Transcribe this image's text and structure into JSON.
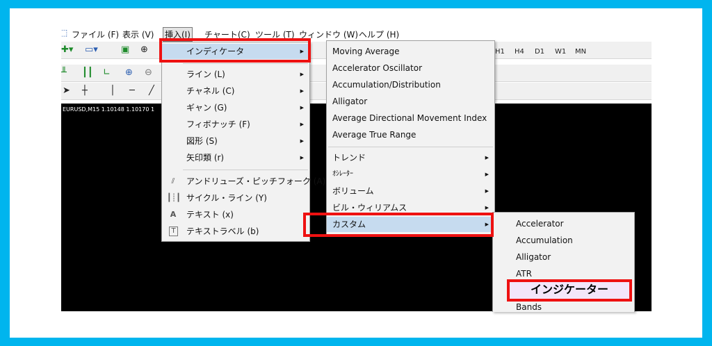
{
  "menubar": {
    "items": [
      {
        "label": "ファイル (F)"
      },
      {
        "label": "表示 (V)"
      },
      {
        "label": "挿入(I)"
      },
      {
        "label": "チャート(C)"
      },
      {
        "label": "ツール (T)"
      },
      {
        "label": "ウィンドウ (W)"
      },
      {
        "label": "ヘルプ (H)"
      }
    ]
  },
  "toolbar": {
    "timeframes": [
      "H1",
      "H4",
      "D1",
      "W1",
      "MN"
    ]
  },
  "chart": {
    "label": "EURUSD,M15  1.10148 1.10170 1"
  },
  "insert_menu": {
    "indicator_label": "インディケータ",
    "items": [
      {
        "label": "ライン (L)"
      },
      {
        "label": "チャネル (C)"
      },
      {
        "label": "ギャン (G)"
      },
      {
        "label": "フィボナッチ (F)"
      },
      {
        "label": "図形 (S)"
      },
      {
        "label": "矢印類 (r)"
      }
    ],
    "tools": [
      {
        "label": "アンドリューズ・ピッチフォーク (A)",
        "icon": "pitchfork-icon"
      },
      {
        "label": "サイクル・ライン (Y)",
        "icon": "cycle-lines-icon"
      },
      {
        "label": "テキスト (x)",
        "icon": "text-icon",
        "glyph": "A"
      },
      {
        "label": "テキストラベル (b)",
        "icon": "text-label-icon",
        "glyph": "T"
      }
    ]
  },
  "indicator_menu": {
    "items": [
      {
        "label": "Moving Average"
      },
      {
        "label": "Accelerator Oscillator"
      },
      {
        "label": "Accumulation/Distribution"
      },
      {
        "label": "Alligator"
      },
      {
        "label": "Average Directional Movement Index"
      },
      {
        "label": "Average True Range"
      }
    ],
    "submenus": [
      {
        "label": "トレンド"
      },
      {
        "label": "ｵｼﾚｰﾀｰ"
      },
      {
        "label": "ボリューム"
      },
      {
        "label": "ビル・ウィリアムス"
      }
    ],
    "custom_label": "カスタム"
  },
  "custom_menu": {
    "items": [
      {
        "label": "Accelerator"
      },
      {
        "label": "Accumulation"
      },
      {
        "label": "Alligator"
      },
      {
        "label": "ATR"
      }
    ],
    "highlighted_label": "インジケーター",
    "last_label": "Bands"
  },
  "colors": {
    "background": "#00b5ee",
    "highlight_border": "#ee1111",
    "selected_item": "#c6dbef",
    "highlighted_fill": "#f3e6fa"
  }
}
